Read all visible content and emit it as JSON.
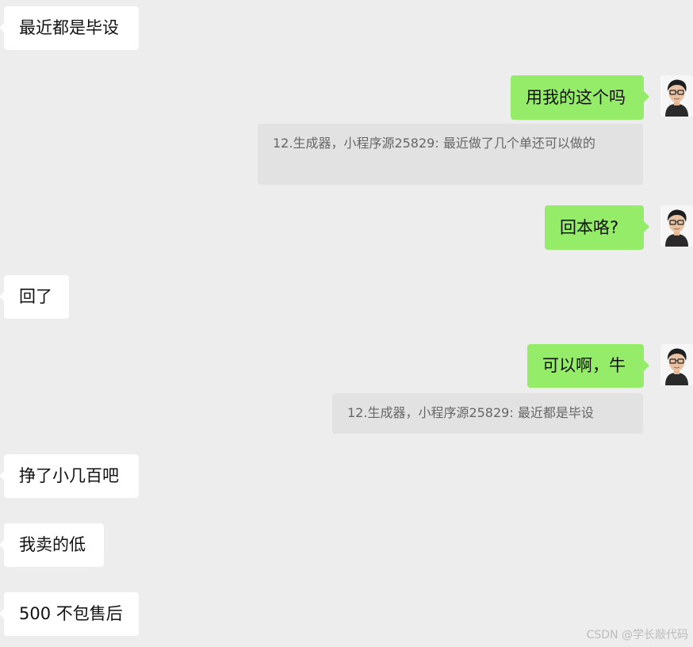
{
  "chat": {
    "messages": [
      {
        "side": "left",
        "text": "最近都是毕设"
      },
      {
        "side": "right",
        "text": "用我的这个吗"
      },
      {
        "side": "quote",
        "text": "12.生成器，小程序源25829: 最近做了几个单还可以做的"
      },
      {
        "side": "right",
        "text": "回本咯?"
      },
      {
        "side": "left",
        "text": "回了"
      },
      {
        "side": "right",
        "text": "可以啊，牛"
      },
      {
        "side": "quote",
        "text": "12.生成器，小程序源25829: 最近都是毕设"
      },
      {
        "side": "left",
        "text": "挣了小几百吧"
      },
      {
        "side": "left",
        "text": "我卖的低"
      },
      {
        "side": "left",
        "text": "500 不包售后"
      }
    ]
  },
  "watermark": "CSDN @学长敲代码",
  "colors": {
    "background": "#ededed",
    "incoming_bubble": "#ffffff",
    "outgoing_bubble": "#95ec69",
    "quote_bubble": "#e2e2e2",
    "quote_text": "#666666",
    "watermark_text": "#bcbcbc"
  },
  "icons": {
    "avatar": "cartoon-avatar-with-glasses-icon"
  }
}
